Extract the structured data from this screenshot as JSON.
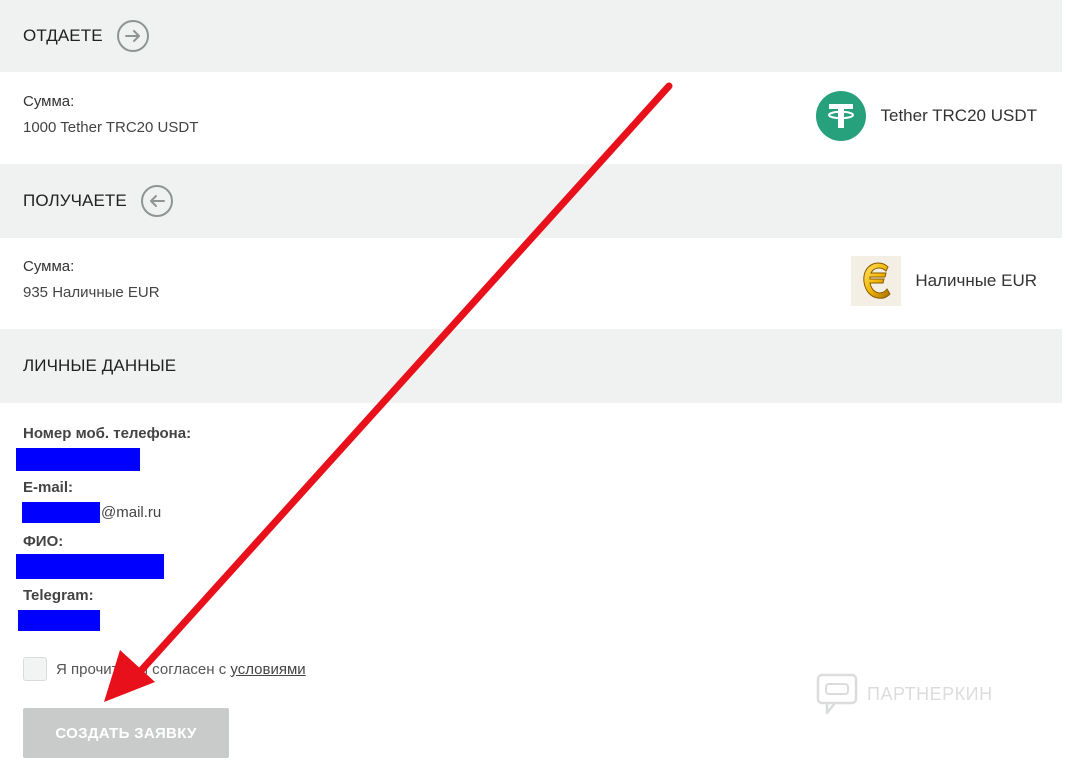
{
  "give": {
    "title": "ОТДАЕТЕ",
    "icon": "arrow-right-circle-icon",
    "amount_label": "Сумма:",
    "amount_value": "1000 Tether TRC20 USDT",
    "currency_name": "Tether TRC20 USDT",
    "currency_icon": "tether-logo-icon"
  },
  "receive": {
    "title": "ПОЛУЧАЕТЕ",
    "icon": "arrow-left-circle-icon",
    "amount_label": "Сумма:",
    "amount_value": "935 Наличные EUR",
    "currency_name": "Наличные EUR",
    "currency_icon": "euro-coin-icon"
  },
  "personal": {
    "title": "ЛИЧНЫЕ ДАННЫЕ",
    "phone_label": "Номер моб. телефона:",
    "email_label": "E-mail:",
    "email_suffix": "@mail.ru",
    "fio_label": "ФИО:",
    "telegram_label": "Telegram:"
  },
  "agreement": {
    "text": "Я прочитал и согласен с ",
    "link": "условиями"
  },
  "submit_label": "СОЗДАТЬ ЗАЯВКУ",
  "watermark": "ПАРТНЕРКИН",
  "colors": {
    "band": "#f0f2f1",
    "tether": "#26a17b",
    "redaction": "#0000ff",
    "arrow": "#e8101a",
    "button_disabled": "#c9cbca"
  }
}
